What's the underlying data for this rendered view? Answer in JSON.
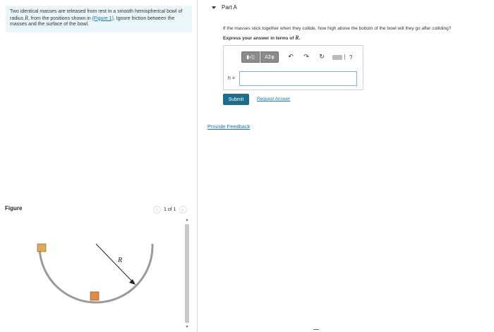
{
  "problem": {
    "text_before_link": "Two identical masses are released from rest in a smooth hemispherical bowl of radius ",
    "radius_symbol": "R",
    "text_mid": ", from the positions shown in ",
    "figure_link": "(Figure 1)",
    "text_after_link": ". Ignore friction between the masses and the surface of the bowl."
  },
  "figure": {
    "label": "Figure",
    "pager_text": "1 of 1",
    "prev_icon": "chevron-left-icon",
    "next_icon": "chevron-right-icon",
    "radius_label": "R",
    "mass_color": "#e0a85a",
    "bowl_color": "#9a9a9a"
  },
  "part": {
    "title": "Part A",
    "question": "If the masses stick together when they collide, how high above the bottom of the bowl will they go after colliding?",
    "instruction_prefix": "Express your answer in terms of ",
    "instruction_symbol": "R",
    "instruction_suffix": "."
  },
  "answer": {
    "templates_label": "▮√▯",
    "greek_label": "ΑΣφ",
    "undo_icon": "↶",
    "redo_icon": "↷",
    "reset_icon": "↻",
    "help_label": "?",
    "variable_label": "h =",
    "input_value": ""
  },
  "actions": {
    "submit": "Submit",
    "request_answer": "Request Answer",
    "provide_feedback": "Provide Feedback"
  },
  "colors": {
    "accent": "#1c6e8c",
    "link": "#1a73b5",
    "problem_bg": "#eaf6f9"
  }
}
